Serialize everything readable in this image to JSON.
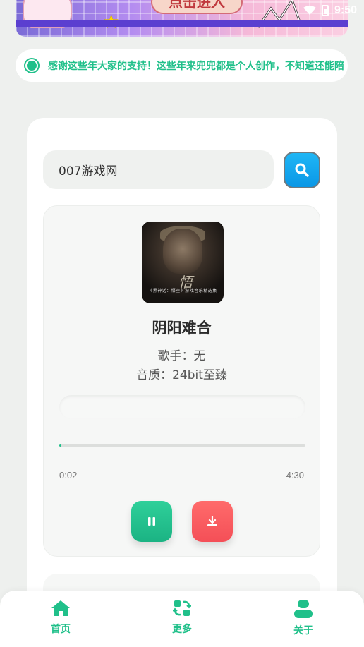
{
  "banner": {
    "button_label": "点击进入"
  },
  "status_bar": {
    "time": "9:50",
    "icons": [
      "wifi-icon",
      "battery-icon"
    ]
  },
  "notice": {
    "text": "感谢这些年大家的支持！这些年来兜兜都是个人创作，不知道还能陪"
  },
  "search": {
    "value": "007游戏网",
    "button_icon": "search-icon"
  },
  "player": {
    "cover_text": "《黑神话：悟空》游戏音乐精选集",
    "title": "阴阳难合",
    "singer": "歌手：无",
    "quality": "音质：24bit至臻",
    "current_time": "0:02",
    "total_time": "4:30",
    "progress": 0.008,
    "pause_icon": "pause-icon",
    "download_icon": "download-icon"
  },
  "nav": {
    "items": [
      {
        "label": "首页",
        "icon": "home-icon"
      },
      {
        "label": "更多",
        "icon": "refresh-grid-icon"
      },
      {
        "label": "关于",
        "icon": "user-icon"
      }
    ]
  },
  "colors": {
    "accent": "#20c08a",
    "search": "#0a97e6",
    "download": "#f44f57"
  }
}
